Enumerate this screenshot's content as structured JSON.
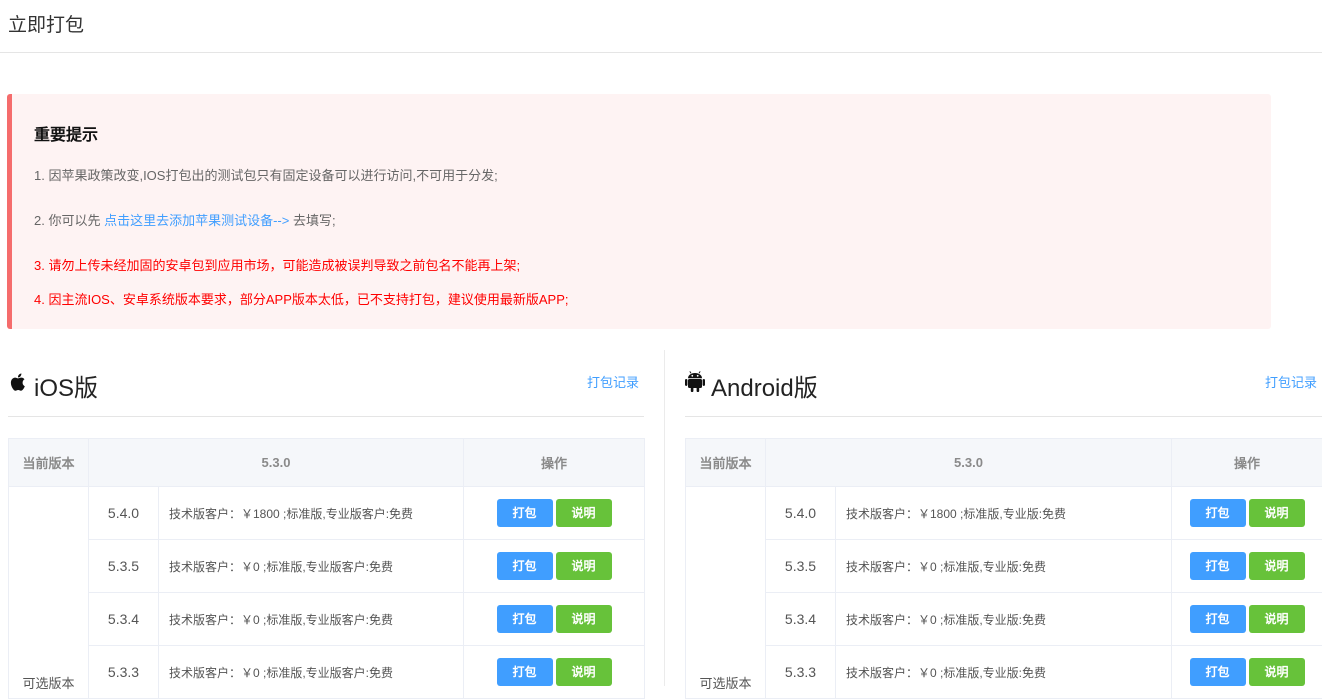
{
  "page_title": "立即打包",
  "notice": {
    "heading": "重要提示",
    "line1": "1. 因苹果政策改变,IOS打包出的测试包只有固定设备可以进行访问,不可用于分发;",
    "line2_prefix": "2. 你可以先",
    "line2_link": "点击这里去添加苹果测试设备-->",
    "line2_suffix": "去填写;",
    "line3": "3. 请勿上传未经加固的安卓包到应用市场，可能造成被误判导致之前包名不能再上架;",
    "line4": "4. 因主流IOS、安卓系统版本要求，部分APP版本太低，已不支持打包，建议使用最新版APP;",
    "accent_color": "#f56c6c",
    "link_color": "#409eff"
  },
  "ios": {
    "title": "iOS版",
    "icon": "apple-icon",
    "record_link": "打包记录",
    "table": {
      "header_current": "当前版本",
      "header_version": "5.3.0",
      "header_ops": "操作",
      "side_label": "可选版本",
      "rows": [
        {
          "version": "5.4.0",
          "desc": "技术版客户：￥1800 ;标准版,专业版客户:免费",
          "pack": "打包",
          "info": "说明"
        },
        {
          "version": "5.3.5",
          "desc": "技术版客户：￥0 ;标准版,专业版客户:免费",
          "pack": "打包",
          "info": "说明"
        },
        {
          "version": "5.3.4",
          "desc": "技术版客户：￥0 ;标准版,专业版客户:免费",
          "pack": "打包",
          "info": "说明"
        },
        {
          "version": "5.3.3",
          "desc": "技术版客户：￥0 ;标准版,专业版客户:免费",
          "pack": "打包",
          "info": "说明"
        }
      ]
    }
  },
  "android": {
    "title": "Android版",
    "icon": "android-icon",
    "record_link": "打包记录",
    "table": {
      "header_current": "当前版本",
      "header_version": "5.3.0",
      "header_ops": "操作",
      "side_label": "可选版本",
      "rows": [
        {
          "version": "5.4.0",
          "desc": "技术版客户：￥1800 ;标准版,专业版:免费",
          "pack": "打包",
          "info": "说明"
        },
        {
          "version": "5.3.5",
          "desc": "技术版客户：￥0 ;标准版,专业版:免费",
          "pack": "打包",
          "info": "说明"
        },
        {
          "version": "5.3.4",
          "desc": "技术版客户：￥0 ;标准版,专业版:免费",
          "pack": "打包",
          "info": "说明"
        },
        {
          "version": "5.3.3",
          "desc": "技术版客户：￥0 ;标准版,专业版:免费",
          "pack": "打包",
          "info": "说明"
        }
      ]
    }
  },
  "colors": {
    "pack_button": "#409eff",
    "info_button": "#67c23a"
  }
}
